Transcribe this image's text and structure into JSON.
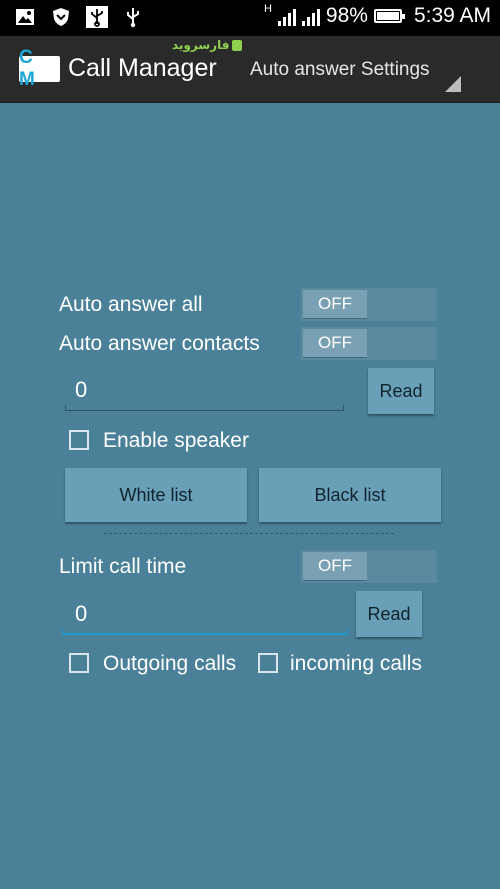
{
  "status_bar": {
    "battery_percent": "98%",
    "battery_level": 0.98,
    "time": "5:39 AM",
    "network_type": "H",
    "icons": [
      "image-icon",
      "shield-icon",
      "usb-debug-icon",
      "usb-icon"
    ]
  },
  "action_bar": {
    "logo_text": "C M",
    "title": "Call Manager",
    "watermark": "فارسروید",
    "spinner_value": "Auto answer Settings"
  },
  "auto_answer": {
    "all_label": "Auto answer all",
    "all_toggle": "OFF",
    "contacts_label": "Auto answer contacts",
    "contacts_toggle": "OFF",
    "delay_value": "0",
    "read_button": "Read",
    "speaker_label": "Enable speaker",
    "speaker_checked": false
  },
  "lists": {
    "white_list": "White list",
    "black_list": "Black list"
  },
  "limit": {
    "label": "Limit call time",
    "toggle": "OFF",
    "time_value": "0",
    "read_button": "Read",
    "outgoing_label": "Outgoing calls",
    "outgoing_checked": false,
    "incoming_label": "incoming calls",
    "incoming_checked": false
  },
  "colors": {
    "background": "#4a8098",
    "action_bar": "#2a2a2a",
    "accent": "#1f9bd1",
    "button": "#69a0b8"
  }
}
